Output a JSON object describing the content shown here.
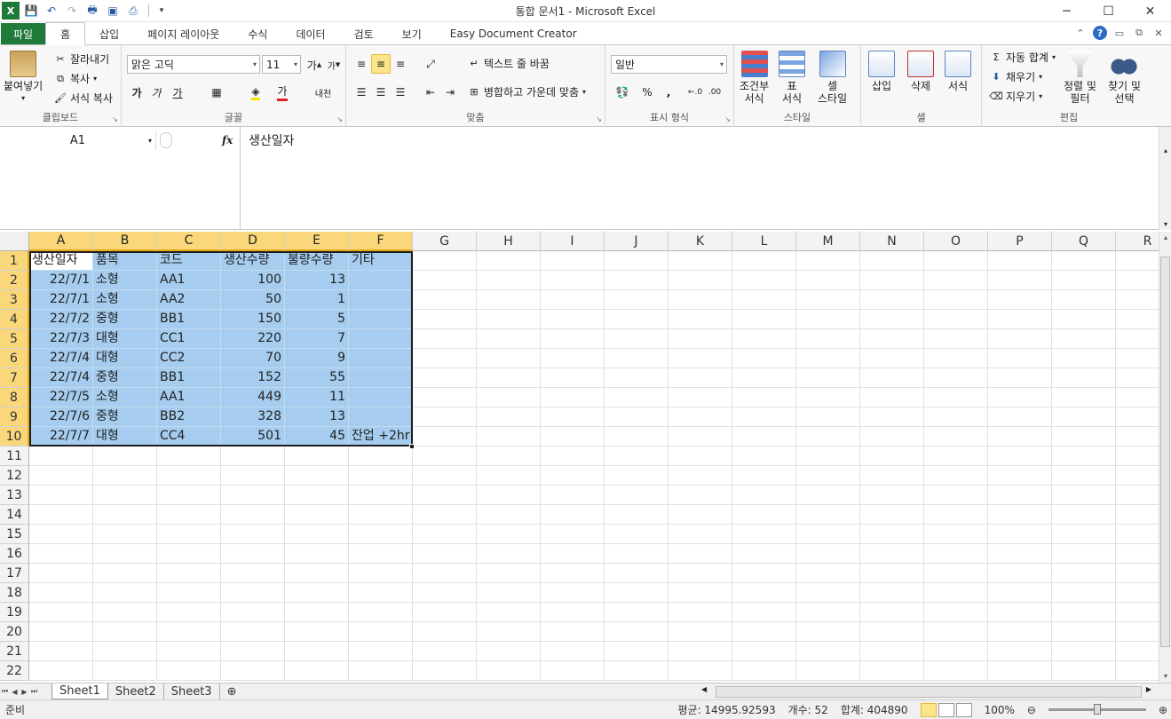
{
  "window": {
    "title": "통합 문서1 - Microsoft Excel",
    "minimize": "─",
    "maximize": "☐",
    "close": "✕"
  },
  "tabs": [
    {
      "label": "파일",
      "type": "file"
    },
    {
      "label": "홈",
      "type": "active"
    },
    {
      "label": "삽입",
      "type": ""
    },
    {
      "label": "페이지 레이아웃",
      "type": ""
    },
    {
      "label": "수식",
      "type": ""
    },
    {
      "label": "데이터",
      "type": ""
    },
    {
      "label": "검토",
      "type": ""
    },
    {
      "label": "보기",
      "type": ""
    },
    {
      "label": "Easy Document Creator",
      "type": ""
    }
  ],
  "ribbon": {
    "clipboard": {
      "paste": "붙여넣기",
      "cut": "잘라내기",
      "copy": "복사",
      "format_painter": "서식 복사",
      "label": "클립보드"
    },
    "font": {
      "name": "맑은 고딕",
      "size": "11",
      "label": "글꼴",
      "bold": "가",
      "italic": "가",
      "underline": "가",
      "font_color": "가",
      "phonetic": "내천"
    },
    "alignment": {
      "wrap": "텍스트 줄 바꿈",
      "merge": "병합하고 가운데 맞춤",
      "label": "맞춤"
    },
    "number": {
      "format": "일반",
      "percent": "%",
      "comma": ",",
      "label": "표시 형식"
    },
    "styles": {
      "conditional": "조건부\n서식",
      "conditional_a": "조건부",
      "conditional_b": "서식",
      "table_a": "표",
      "table_b": "서식",
      "cell_a": "셀",
      "cell_b": "스타일",
      "label": "스타일"
    },
    "cells": {
      "insert": "삽입",
      "delete": "삭제",
      "format": "서식",
      "label": "셀"
    },
    "editing": {
      "autosum": "자동 합계",
      "fill": "채우기",
      "clear": "지우기",
      "sort_a": "정렬 및",
      "sort_b": "필터",
      "find_a": "찾기 및",
      "find_b": "선택",
      "label": "편집"
    }
  },
  "formula_bar": {
    "name_box": "A1",
    "fx": "fx",
    "content": "생산일자"
  },
  "columns": [
    "A",
    "B",
    "C",
    "D",
    "E",
    "F",
    "G",
    "H",
    "I",
    "J",
    "K",
    "L",
    "M",
    "N",
    "O",
    "P",
    "Q",
    "R"
  ],
  "rows": [
    [
      "생산일자",
      "품목",
      "코드",
      "생산수량",
      "불량수량",
      "기타"
    ],
    [
      "22/7/1",
      "소형",
      "AA1",
      "100",
      "13",
      ""
    ],
    [
      "22/7/1",
      "소형",
      "AA2",
      "50",
      "1",
      ""
    ],
    [
      "22/7/2",
      "중형",
      "BB1",
      "150",
      "5",
      ""
    ],
    [
      "22/7/3",
      "대형",
      "CC1",
      "220",
      "7",
      ""
    ],
    [
      "22/7/4",
      "대형",
      "CC2",
      "70",
      "9",
      ""
    ],
    [
      "22/7/4",
      "중형",
      "BB1",
      "152",
      "55",
      ""
    ],
    [
      "22/7/5",
      "소형",
      "AA1",
      "449",
      "11",
      ""
    ],
    [
      "22/7/6",
      "중형",
      "BB2",
      "328",
      "13",
      ""
    ],
    [
      "22/7/7",
      "대형",
      "CC4",
      "501",
      "45",
      "잔업 +2hr"
    ],
    [],
    [],
    [],
    [],
    [],
    [],
    [],
    [],
    [],
    [],
    [],
    []
  ],
  "sheets": [
    "Sheet1",
    "Sheet2",
    "Sheet3"
  ],
  "status": {
    "mode": "준비",
    "average": "평균: 14995.92593",
    "count": "개수: 52",
    "sum": "합계: 404890",
    "zoom": "100%"
  }
}
